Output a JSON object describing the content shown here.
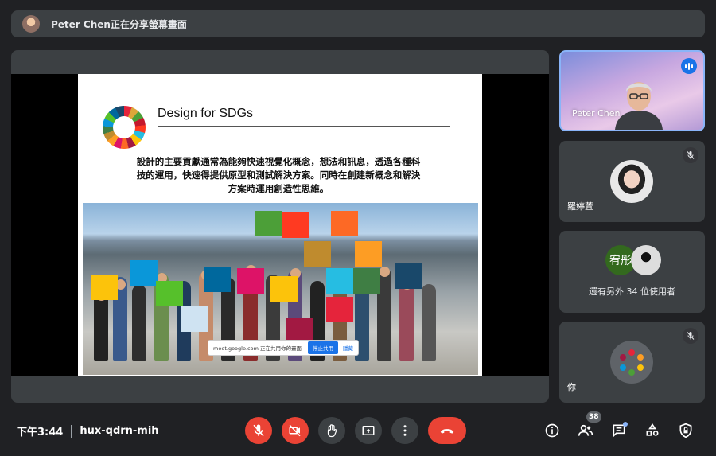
{
  "banner": {
    "text": "Peter Chen正在分享螢幕畫面"
  },
  "slide": {
    "title": "Design for SDGs",
    "body": "設計的主要貢獻通常為能夠快速視覺化概念，想法和訊息，透過各種科技的運用，快速得提供原型和測試解決方案。同時在創建新概念和解決方案時運用創造性思維。",
    "share_toast": {
      "message": "meet.google.com 正在共用你的畫面",
      "stop_label": "停止共用",
      "hide_label": "隱藏"
    }
  },
  "participants": [
    {
      "name": "Peter Chen",
      "speaking": true
    },
    {
      "name": "羅婷萱",
      "muted": true
    },
    {
      "name": "你",
      "muted": true
    }
  ],
  "others": {
    "initial": "宥彤",
    "text": "還有另外 34 位使用者"
  },
  "bottom": {
    "time": "下午3:44",
    "meeting_code": "hux-qdrn-mih",
    "people_count": "38"
  },
  "colors": {
    "end_call": "#ea4335",
    "active_tile_border": "#8ab4f8",
    "bar_bg": "#3c4043"
  },
  "icons": [
    "mic-off-icon",
    "camera-off-icon",
    "raise-hand-icon",
    "present-icon",
    "more-icon",
    "end-call-icon",
    "info-icon",
    "people-icon",
    "chat-icon",
    "activities-icon",
    "host-controls-icon"
  ]
}
